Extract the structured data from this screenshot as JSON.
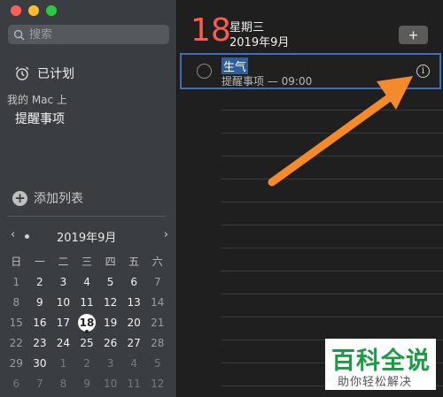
{
  "sidebar": {
    "search_placeholder": "搜索",
    "scheduled_label": "已计划",
    "section_header": "我的 Mac 上",
    "lists": [
      {
        "label": "提醒事项"
      }
    ],
    "add_list_label": "添加列表"
  },
  "calendar": {
    "month_label": "2019年9月",
    "prev_icon": "‹",
    "next_icon": "›",
    "weekdays": [
      "日",
      "一",
      "二",
      "三",
      "四",
      "五",
      "六"
    ],
    "weeks": [
      [
        "1",
        "2",
        "3",
        "4",
        "5",
        "6",
        "7"
      ],
      [
        "8",
        "9",
        "10",
        "11",
        "12",
        "13",
        "14"
      ],
      [
        "15",
        "16",
        "17",
        "18",
        "19",
        "20",
        "21"
      ],
      [
        "22",
        "23",
        "24",
        "25",
        "26",
        "27",
        "28"
      ],
      [
        "29",
        "30",
        "1",
        "2",
        "3",
        "4",
        "5"
      ],
      [
        "6",
        "7",
        "8",
        "9",
        "10",
        "11",
        "12"
      ]
    ],
    "selected_day": "18"
  },
  "main": {
    "day_number": "18",
    "weekday": "星期三",
    "full_date": "2019年9月",
    "add_button_label": "+",
    "reminder": {
      "title": "生气",
      "subtitle": "提醒事项 — 09:00"
    }
  },
  "watermark": {
    "title": "百科全说",
    "subtitle": "助你轻松解决"
  },
  "colors": {
    "accent_red": "#fd5b4f",
    "selection_blue": "#3c6fb8",
    "arrow_orange": "#f58a2c",
    "watermark_green": "#1a9c44"
  }
}
